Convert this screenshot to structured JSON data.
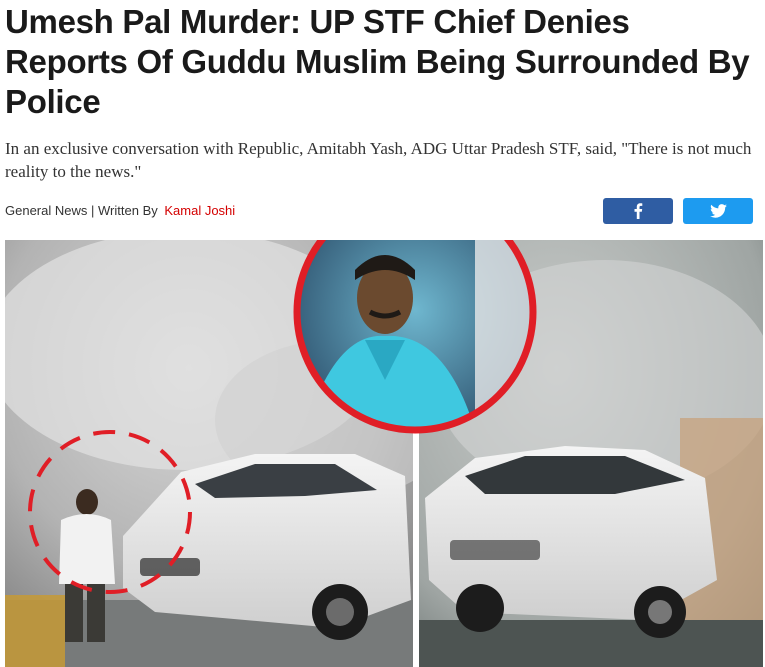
{
  "article": {
    "headline": "Umesh Pal Murder: UP STF Chief Denies Reports Of Guddu Muslim Being Surrounded By Police",
    "summary": "In an exclusive conversation with Republic, Amitabh Yash, ADG Uttar Pradesh STF, said, \"There is not much reality to the news.\"",
    "category": "General News",
    "separator": "|",
    "written_by_label": "Written By",
    "author": "Kamal Joshi"
  },
  "share": {
    "facebook_icon": "facebook-icon",
    "twitter_icon": "twitter-icon",
    "facebook_color": "#2f5da3",
    "twitter_color": "#1d9bf0"
  },
  "hero_image": {
    "left_panel": "cctv-still-man-near-white-car",
    "right_panel": "cctv-still-white-suv",
    "inset": "circled-portrait-man-in-blue-shirt",
    "highlight_color": "#e01e26"
  },
  "colors": {
    "author_link": "#d40000",
    "headline_text": "#1a1a1a"
  }
}
